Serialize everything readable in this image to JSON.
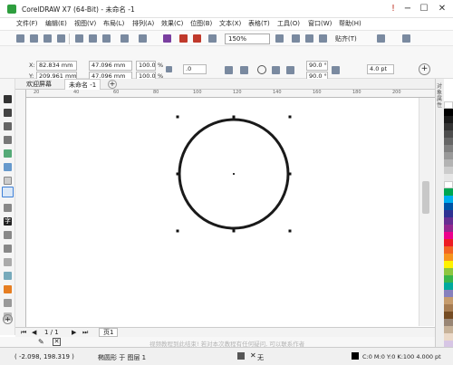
{
  "app": {
    "title": "CorelDRAW X7 (64-Bit) - 未命名 -1"
  },
  "window_controls": [
    "!",
    "−",
    "☐",
    "✕"
  ],
  "menu": [
    "文件(F)",
    "编辑(E)",
    "视图(V)",
    "布局(L)",
    "排列(A)",
    "效果(C)",
    "位图(B)",
    "文本(X)",
    "表格(T)",
    "工具(O)",
    "窗口(W)",
    "帮助(H)"
  ],
  "standard_toolbar": {
    "zoom": "150%",
    "snap_label": "贴齐(T)"
  },
  "property_bar": {
    "x": "82.834 mm",
    "y": "209.961 mm",
    "w": "47.096 mm",
    "h": "47.096 mm",
    "sx": "100.0",
    "sy": "100.0",
    "pct": "%",
    "rotation": ".0",
    "start_angle": "90.0 °",
    "end_angle": "90.0 °",
    "outline": "4.0 pt",
    "x_label": "X:",
    "y_label": "Y:"
  },
  "tabs": [
    "欢迎屏幕",
    "未命名 -1"
  ],
  "ruler_ticks_h": [
    "20",
    "40",
    "60",
    "80",
    "100",
    "120",
    "140",
    "160",
    "180",
    "200"
  ],
  "page_nav": {
    "page_counter": "1 / 1",
    "page_tab": "页1"
  },
  "docker": {
    "label": "对象属性"
  },
  "palette": [
    "#ffffff",
    "#000000",
    "#1a1a1a",
    "#333333",
    "#4d4d4d",
    "#666666",
    "#808080",
    "#999999",
    "#b3b3b3",
    "#cccccc",
    "#e6e6e6",
    "#ffffff",
    "#00a651",
    "#00aeef",
    "#0054a6",
    "#2e3192",
    "#662d91",
    "#92278f",
    "#ec008c",
    "#ed1c24",
    "#f26522",
    "#f7941d",
    "#fff200",
    "#8dc63f",
    "#39b54a",
    "#00a99d",
    "#8781bd",
    "#c69c6d",
    "#a67c52",
    "#754c24",
    "#998675",
    "#c7b299",
    "#ebd9c8",
    "#d7c6e5"
  ],
  "status": {
    "coords": "( -2.098, 198.319 )",
    "object": "椭圆形 于 图层 1",
    "fill": "无",
    "outline_info": "C:0 M:0 Y:0 K:100  4.000 pt"
  },
  "watermark_text": "视频教程到此结束! 若对本次教程有任何疑问, 可以联系作者",
  "colors": {
    "accent": "#2e9e3e",
    "ellipse_stroke": "#1a1a1a"
  }
}
